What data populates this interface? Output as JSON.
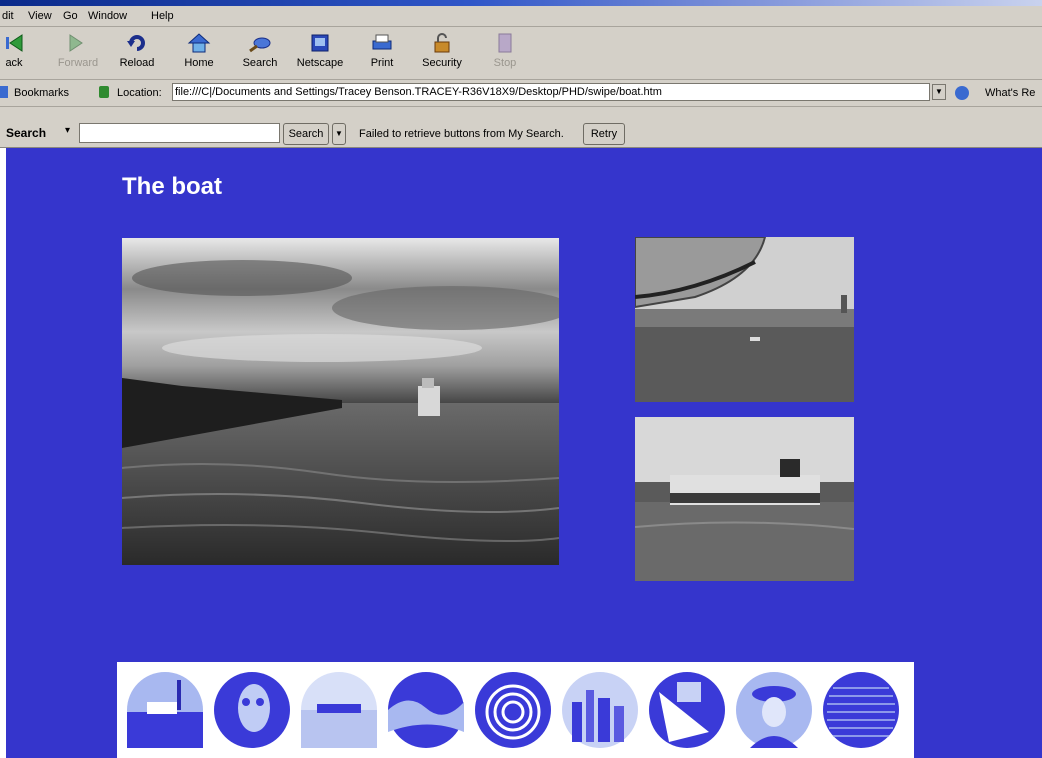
{
  "browser": {
    "menu": [
      {
        "label": "Edit",
        "visible": "dit",
        "accel": "E"
      },
      {
        "label": "View",
        "accel": "V"
      },
      {
        "label": "Go",
        "accel": "G"
      },
      {
        "label": "Window",
        "accel": "W"
      },
      {
        "label": "Help",
        "accel": "H"
      }
    ],
    "toolbar": [
      {
        "label": "Back",
        "visible": "ack",
        "icon": "back-arrow-icon",
        "enabled": true
      },
      {
        "label": "Forward",
        "icon": "forward-arrow-icon",
        "enabled": false
      },
      {
        "label": "Reload",
        "icon": "reload-icon",
        "enabled": true
      },
      {
        "label": "Home",
        "icon": "home-icon",
        "enabled": true
      },
      {
        "label": "Search",
        "icon": "search-icon",
        "enabled": true
      },
      {
        "label": "Netscape",
        "icon": "netscape-icon",
        "enabled": true
      },
      {
        "label": "Print",
        "icon": "print-icon",
        "enabled": true
      },
      {
        "label": "Security",
        "icon": "lock-icon",
        "enabled": true
      },
      {
        "label": "Stop",
        "icon": "stop-icon",
        "enabled": false
      }
    ],
    "location": {
      "bookmarks_label": "Bookmarks",
      "location_label": "Location:",
      "url": "file:///C|/Documents and Settings/Tracey Benson.TRACEY-R36V18X9/Desktop/PHD/swipe/boat.htm",
      "whats_related": "What's Re"
    },
    "searchbar": {
      "label": "Search",
      "input_value": "",
      "search_button": "Search",
      "message": "Failed to retrieve buttons from My Search.",
      "retry_button": "Retry"
    }
  },
  "page": {
    "title": "The boat",
    "background": "#3535cc",
    "photos": [
      {
        "name": "main-photo",
        "subject": "ship on river at dusk"
      },
      {
        "name": "side-photo-1",
        "subject": "harbour city view from ship"
      },
      {
        "name": "side-photo-2",
        "subject": "ferry in harbour"
      }
    ],
    "thumbnails": [
      "boat",
      "portrait-with-glasses",
      "ferry",
      "landscape",
      "fingerprint",
      "city-skyline",
      "building-collage",
      "man-with-hat",
      "text-pattern"
    ]
  }
}
